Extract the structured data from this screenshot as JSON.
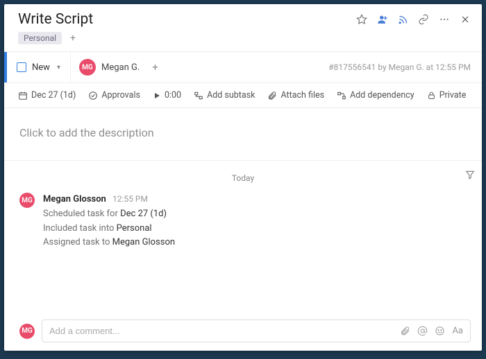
{
  "title": "Write Script",
  "tags": {
    "items": [
      "Personal"
    ]
  },
  "status": {
    "label": "New"
  },
  "assignee": {
    "initials": "MG",
    "name": "Megan G."
  },
  "meta": "#817556541 by Megan G. at 12:55 PM",
  "toolbar": {
    "date": "Dec 27 (1d)",
    "approvals": "Approvals",
    "time": "0:00",
    "subtask": "Add subtask",
    "attach": "Attach files",
    "dependency": "Add dependency",
    "private": "Private"
  },
  "description_placeholder": "Click to add the description",
  "activity": {
    "day": "Today",
    "entry": {
      "initials": "MG",
      "author": "Megan Glosson",
      "time": "12:55 PM",
      "l1a": "Scheduled task for ",
      "l1b": "Dec 27 (1d)",
      "l2a": "Included task into ",
      "l2b": "Personal",
      "l3a": "Assigned task to ",
      "l3b": "Megan Glosson"
    }
  },
  "comment": {
    "initials": "MG",
    "placeholder": "Add a comment..."
  }
}
